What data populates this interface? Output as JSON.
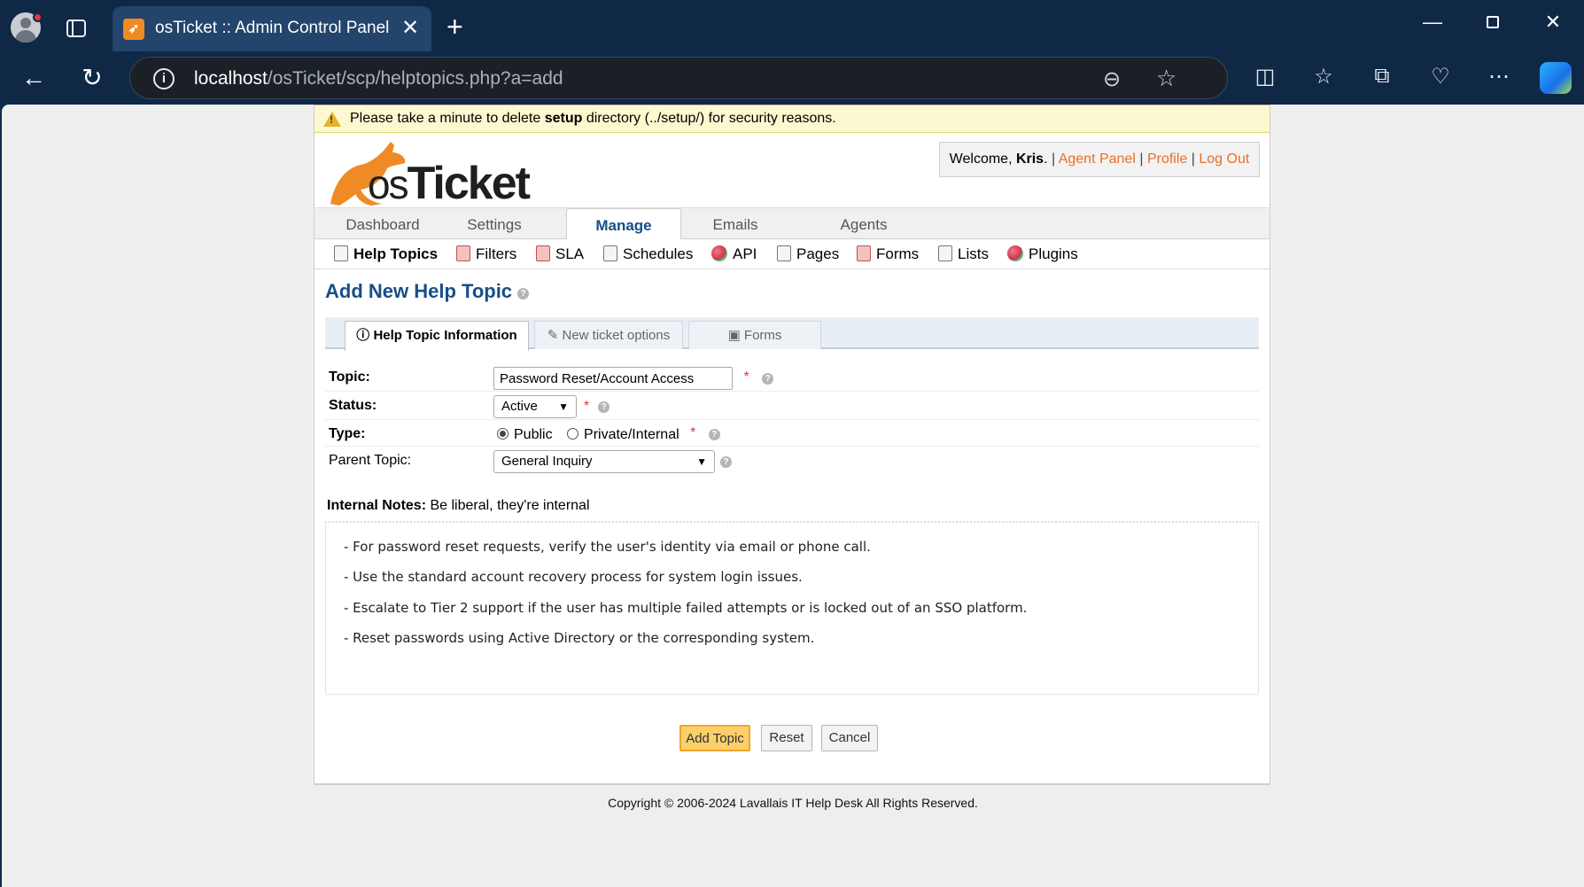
{
  "browser": {
    "tab_title": "osTicket :: Admin Control Panel",
    "url_host": "localhost",
    "url_path": "/osTicket/scp/helptopics.php?a=add"
  },
  "warning": {
    "prefix": "Please take a minute to delete ",
    "bold": "setup",
    "suffix": " directory (../setup/) for security reasons."
  },
  "logo": {
    "prefix": "os",
    "suffix": "Ticket"
  },
  "user_bar": {
    "welcome": "Welcome, ",
    "user": "Kris",
    "dot": ".",
    "agent_panel": "Agent Panel",
    "profile": "Profile",
    "logout": "Log Out"
  },
  "nav": {
    "items": [
      "Dashboard",
      "Settings",
      "Manage",
      "Emails",
      "Agents"
    ],
    "active": "Manage"
  },
  "subnav": {
    "items": [
      "Help Topics",
      "Filters",
      "SLA",
      "Schedules",
      "API",
      "Pages",
      "Forms",
      "Lists",
      "Plugins"
    ]
  },
  "page": {
    "title": "Add New Help Topic"
  },
  "form_tabs": [
    "Help Topic Information",
    "New ticket options",
    "Forms"
  ],
  "form": {
    "topic_label": "Topic:",
    "topic_value": "Password Reset/Account Access",
    "status_label": "Status:",
    "status_value": "Active",
    "type_label": "Type:",
    "type_public": "Public",
    "type_private": "Private/Internal",
    "parent_label": "Parent Topic:",
    "parent_value": "General Inquiry",
    "required_mark": "*",
    "notes_label": "Internal Notes:",
    "notes_hint": "Be liberal, they're internal",
    "notes_lines": [
      "- For password reset requests, verify the user's identity via email or phone call.",
      "- Use the standard account recovery process for system login issues.",
      "- Escalate to Tier 2 support if the user has multiple failed attempts or is locked out of an SSO platform.",
      "- Reset passwords using Active Directory or the corresponding system."
    ]
  },
  "buttons": {
    "add": "Add Topic",
    "reset": "Reset",
    "cancel": "Cancel"
  },
  "footer": "Copyright © 2006-2024 Lavallais IT Help Desk All Rights Reserved.",
  "colors": {
    "brand_orange": "#e5702c",
    "title_blue": "#184e87",
    "button_yellow": "#fbd06b"
  }
}
